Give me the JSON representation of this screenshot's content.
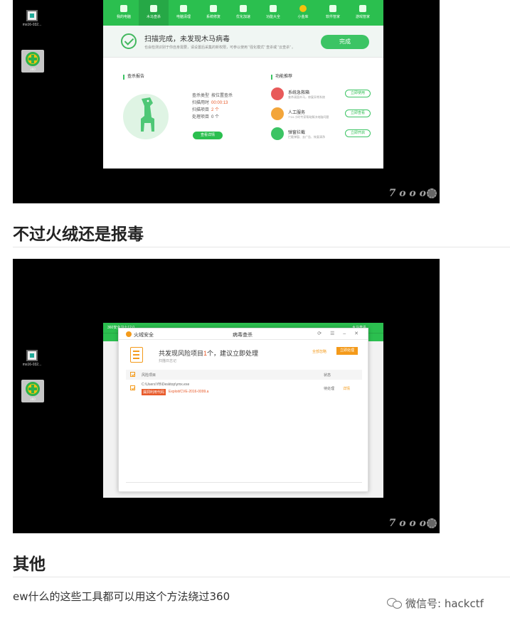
{
  "screenshot1": {
    "desktop_icons": [
      {
        "label": "ms16-032...",
        "icon": "exe-file-icon"
      },
      {
        "label": "",
        "icon": "360-security-icon"
      }
    ],
    "toolbar": [
      "我的电脑",
      "木马查杀",
      "电脑清理",
      "系统修复",
      "优化加速",
      "功能大全",
      "小金库",
      "软件管家",
      "游戏管家"
    ],
    "banner": {
      "title": "扫描完成，未发现木马病毒",
      "subtitle": "也会检测识别于你自身需要，请设置后采集的新权限，可参以使用 “强化模式” 查杀或 “云查杀” 。",
      "done_label": "完成"
    },
    "report": {
      "section_title": "查杀报告",
      "rows": [
        {
          "label": "查杀类型",
          "value": "按位置查杀",
          "highlight": false
        },
        {
          "label": "扫描用时",
          "value": "00:00:13",
          "highlight": true
        },
        {
          "label": "扫描项目",
          "value": "2 个",
          "highlight": true
        },
        {
          "label": "处理项目",
          "value": "0 个",
          "highlight": false
        }
      ],
      "log_button": "查看详情"
    },
    "recommend": {
      "section_title": "功能推荐",
      "items": [
        {
          "name": "系统急救箱",
          "desc": "查杀顽固木马，修复异常系统",
          "button": "立即使用",
          "icon": "first-aid-kit-icon",
          "color": "#e85a5a"
        },
        {
          "name": "人工服务",
          "desc": "7*24 小时专家帮助解决电脑问题",
          "button": "立即查看",
          "icon": "support-agent-icon",
          "color": "#f3a53a"
        },
        {
          "name": "弹窗拦截",
          "desc": "拦截弹窗、去广告、恢复清净",
          "button": "立即开启",
          "icon": "popup-block-icon",
          "color": "#3cc464"
        }
      ]
    },
    "watermark": "7 o o o"
  },
  "heading1": "不过火绒还是报毒",
  "screenshot2": {
    "desktop_icons": [
      {
        "label": "ms16-032...",
        "icon": "exe-file-icon"
      },
      {
        "label": "",
        "icon": "360-security-icon"
      }
    ],
    "bg_window": {
      "title": "360安全卫士12.0",
      "right_text": "木马查杀"
    },
    "huorong": {
      "brand": "火绒安全",
      "center_title": "病毒查杀",
      "controls": "⟳ ☰ – ✕",
      "headline_pre": "共发现风险项目",
      "headline_num": "1",
      "headline_post": "个，建议立即处理",
      "scan_time": "扫描日志记",
      "ignore_all": "全部忽略",
      "handle_now": "立即处理",
      "col_item": "风险项目",
      "col_status": "状态",
      "file_path": "C:\\Users\\YB\\Desktop\\ymx.exe",
      "threat_tag": "漏洞利用代码",
      "threat_name": "Exploit/CVE-2016-0099.a",
      "status": "待处理",
      "detail": "详情"
    },
    "watermark": "7 o o o"
  },
  "heading2": "其他",
  "paragraph": "ew什么的这些工具都可以用这个方法绕过360",
  "wechat": {
    "label": "微信号: hackctf",
    "icon": "wechat-icon"
  }
}
